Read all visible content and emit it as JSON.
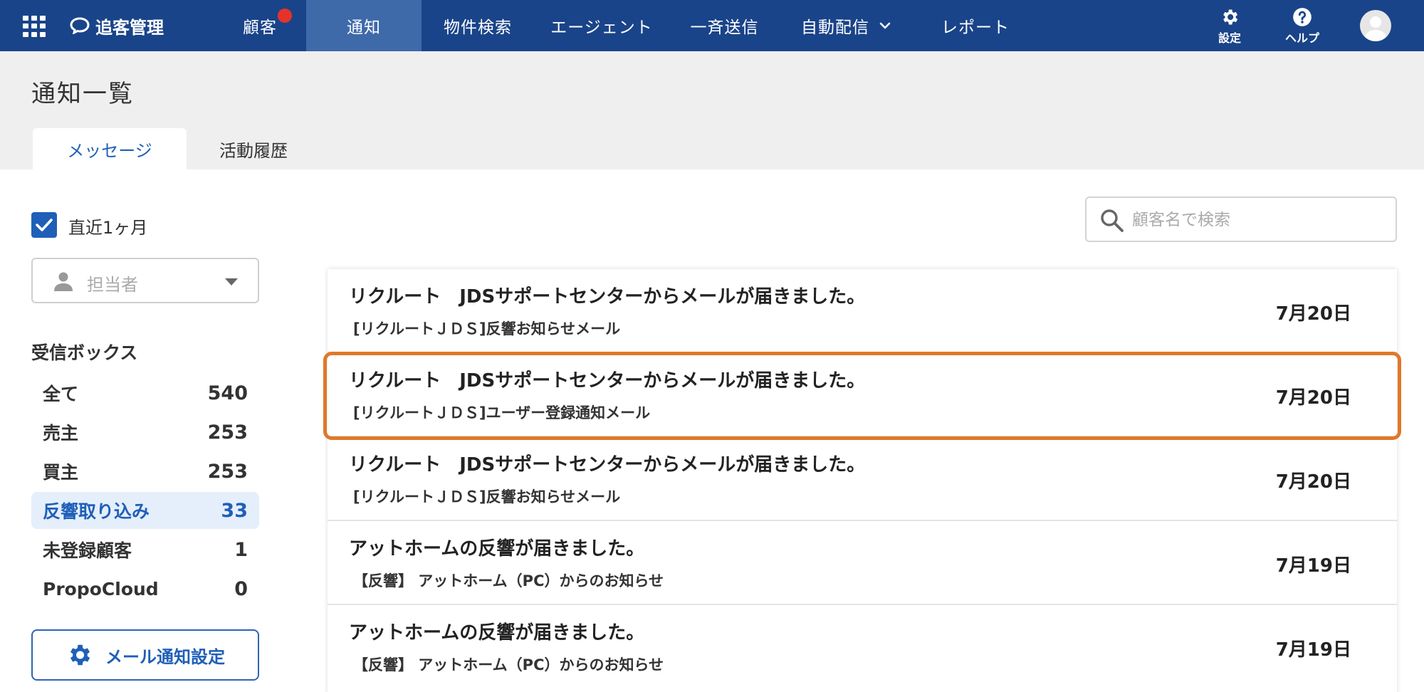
{
  "nav": {
    "brand": "追客管理",
    "items": [
      {
        "label": "顧客"
      },
      {
        "label": "通知"
      },
      {
        "label": "物件検索"
      },
      {
        "label": "エージェント"
      },
      {
        "label": "一斉送信"
      },
      {
        "label": "自動配信"
      },
      {
        "label": "レポート"
      }
    ],
    "settings_label": "設定",
    "help_label": "ヘルプ",
    "colors": {
      "bar": "#1a4489",
      "active": "#3e6aaa",
      "badge": "#e5332a"
    }
  },
  "page": {
    "title": "通知一覧",
    "tabs": [
      {
        "label": "メッセージ"
      },
      {
        "label": "活動履歴"
      }
    ]
  },
  "filters": {
    "recent_checkbox_label": "直近1ヶ月",
    "recent_checked": true,
    "assignee_placeholder": "担当者"
  },
  "inbox": {
    "title": "受信ボックス",
    "items": [
      {
        "label": "全て",
        "count": "540"
      },
      {
        "label": "売主",
        "count": "253"
      },
      {
        "label": "買主",
        "count": "253"
      },
      {
        "label": "反響取り込み",
        "count": "33"
      },
      {
        "label": "未登録顧客",
        "count": "1"
      },
      {
        "label": "PropoCloud",
        "count": "0"
      }
    ],
    "active_index": 3
  },
  "mail_settings_button": "メール通知設定",
  "search": {
    "placeholder": "顧客名で検索"
  },
  "messages": [
    {
      "title": "リクルート　JDSサポートセンターからメールが届きました。",
      "subtitle": "[リクルートＪＤＳ]反響お知らせメール",
      "date": "7月20日"
    },
    {
      "title": "リクルート　JDSサポートセンターからメールが届きました。",
      "subtitle": "[リクルートＪＤＳ]ユーザー登録通知メール",
      "date": "7月20日"
    },
    {
      "title": "リクルート　JDSサポートセンターからメールが届きました。",
      "subtitle": "[リクルートＪＤＳ]反響お知らせメール",
      "date": "7月20日"
    },
    {
      "title": "アットホームの反響が届きました。",
      "subtitle": "【反響】 アットホーム（PC）からのお知らせ",
      "date": "7月19日"
    },
    {
      "title": "アットホームの反響が届きました。",
      "subtitle": "【反響】 アットホーム（PC）からのお知らせ",
      "date": "7月19日"
    }
  ],
  "highlight_color": "#e0782a"
}
